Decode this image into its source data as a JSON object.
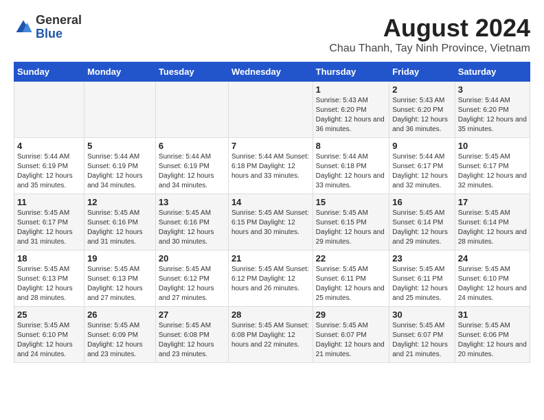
{
  "logo": {
    "line1": "General",
    "line2": "Blue"
  },
  "title": "August 2024",
  "subtitle": "Chau Thanh, Tay Ninh Province, Vietnam",
  "headers": [
    "Sunday",
    "Monday",
    "Tuesday",
    "Wednesday",
    "Thursday",
    "Friday",
    "Saturday"
  ],
  "weeks": [
    [
      {
        "day": "",
        "info": ""
      },
      {
        "day": "",
        "info": ""
      },
      {
        "day": "",
        "info": ""
      },
      {
        "day": "",
        "info": ""
      },
      {
        "day": "1",
        "info": "Sunrise: 5:43 AM\nSunset: 6:20 PM\nDaylight: 12 hours\nand 36 minutes."
      },
      {
        "day": "2",
        "info": "Sunrise: 5:43 AM\nSunset: 6:20 PM\nDaylight: 12 hours\nand 36 minutes."
      },
      {
        "day": "3",
        "info": "Sunrise: 5:44 AM\nSunset: 6:20 PM\nDaylight: 12 hours\nand 35 minutes."
      }
    ],
    [
      {
        "day": "4",
        "info": "Sunrise: 5:44 AM\nSunset: 6:19 PM\nDaylight: 12 hours\nand 35 minutes."
      },
      {
        "day": "5",
        "info": "Sunrise: 5:44 AM\nSunset: 6:19 PM\nDaylight: 12 hours\nand 34 minutes."
      },
      {
        "day": "6",
        "info": "Sunrise: 5:44 AM\nSunset: 6:19 PM\nDaylight: 12 hours\nand 34 minutes."
      },
      {
        "day": "7",
        "info": "Sunrise: 5:44 AM\nSunset: 6:18 PM\nDaylight: 12 hours\nand 33 minutes."
      },
      {
        "day": "8",
        "info": "Sunrise: 5:44 AM\nSunset: 6:18 PM\nDaylight: 12 hours\nand 33 minutes."
      },
      {
        "day": "9",
        "info": "Sunrise: 5:44 AM\nSunset: 6:17 PM\nDaylight: 12 hours\nand 32 minutes."
      },
      {
        "day": "10",
        "info": "Sunrise: 5:45 AM\nSunset: 6:17 PM\nDaylight: 12 hours\nand 32 minutes."
      }
    ],
    [
      {
        "day": "11",
        "info": "Sunrise: 5:45 AM\nSunset: 6:17 PM\nDaylight: 12 hours\nand 31 minutes."
      },
      {
        "day": "12",
        "info": "Sunrise: 5:45 AM\nSunset: 6:16 PM\nDaylight: 12 hours\nand 31 minutes."
      },
      {
        "day": "13",
        "info": "Sunrise: 5:45 AM\nSunset: 6:16 PM\nDaylight: 12 hours\nand 30 minutes."
      },
      {
        "day": "14",
        "info": "Sunrise: 5:45 AM\nSunset: 6:15 PM\nDaylight: 12 hours\nand 30 minutes."
      },
      {
        "day": "15",
        "info": "Sunrise: 5:45 AM\nSunset: 6:15 PM\nDaylight: 12 hours\nand 29 minutes."
      },
      {
        "day": "16",
        "info": "Sunrise: 5:45 AM\nSunset: 6:14 PM\nDaylight: 12 hours\nand 29 minutes."
      },
      {
        "day": "17",
        "info": "Sunrise: 5:45 AM\nSunset: 6:14 PM\nDaylight: 12 hours\nand 28 minutes."
      }
    ],
    [
      {
        "day": "18",
        "info": "Sunrise: 5:45 AM\nSunset: 6:13 PM\nDaylight: 12 hours\nand 28 minutes."
      },
      {
        "day": "19",
        "info": "Sunrise: 5:45 AM\nSunset: 6:13 PM\nDaylight: 12 hours\nand 27 minutes."
      },
      {
        "day": "20",
        "info": "Sunrise: 5:45 AM\nSunset: 6:12 PM\nDaylight: 12 hours\nand 27 minutes."
      },
      {
        "day": "21",
        "info": "Sunrise: 5:45 AM\nSunset: 6:12 PM\nDaylight: 12 hours\nand 26 minutes."
      },
      {
        "day": "22",
        "info": "Sunrise: 5:45 AM\nSunset: 6:11 PM\nDaylight: 12 hours\nand 25 minutes."
      },
      {
        "day": "23",
        "info": "Sunrise: 5:45 AM\nSunset: 6:11 PM\nDaylight: 12 hours\nand 25 minutes."
      },
      {
        "day": "24",
        "info": "Sunrise: 5:45 AM\nSunset: 6:10 PM\nDaylight: 12 hours\nand 24 minutes."
      }
    ],
    [
      {
        "day": "25",
        "info": "Sunrise: 5:45 AM\nSunset: 6:10 PM\nDaylight: 12 hours\nand 24 minutes."
      },
      {
        "day": "26",
        "info": "Sunrise: 5:45 AM\nSunset: 6:09 PM\nDaylight: 12 hours\nand 23 minutes."
      },
      {
        "day": "27",
        "info": "Sunrise: 5:45 AM\nSunset: 6:08 PM\nDaylight: 12 hours\nand 23 minutes."
      },
      {
        "day": "28",
        "info": "Sunrise: 5:45 AM\nSunset: 6:08 PM\nDaylight: 12 hours\nand 22 minutes."
      },
      {
        "day": "29",
        "info": "Sunrise: 5:45 AM\nSunset: 6:07 PM\nDaylight: 12 hours\nand 21 minutes."
      },
      {
        "day": "30",
        "info": "Sunrise: 5:45 AM\nSunset: 6:07 PM\nDaylight: 12 hours\nand 21 minutes."
      },
      {
        "day": "31",
        "info": "Sunrise: 5:45 AM\nSunset: 6:06 PM\nDaylight: 12 hours\nand 20 minutes."
      }
    ]
  ]
}
